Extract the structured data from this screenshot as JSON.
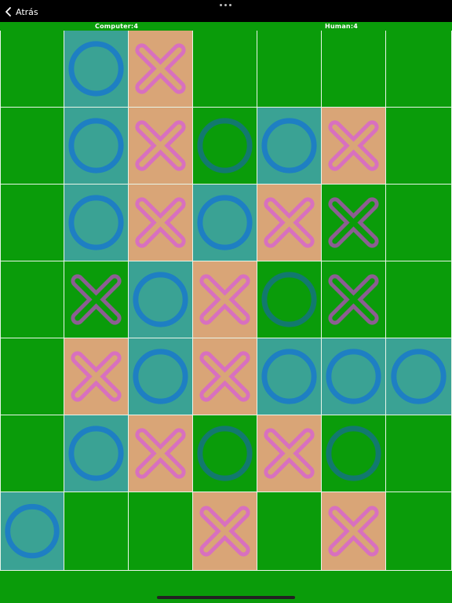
{
  "nav": {
    "back_label": "Atrás"
  },
  "scores": {
    "computer": "Computer:4",
    "human": "Human:4"
  },
  "colors": {
    "board": "#0a9c0a",
    "line": "#e8f5e8",
    "o_highlight_bg": "#3aa294",
    "x_highlight_bg": "#d9a577",
    "o_highlight_stroke": "#1e7fc3",
    "x_highlight_stroke": "#d870bf",
    "o_plain_stroke": "#12796e",
    "x_plain_stroke": "#8c5e92"
  },
  "board": {
    "rows": 7,
    "cols": 7,
    "cells": [
      [
        "",
        "O*",
        "X*",
        "",
        "",
        "",
        ""
      ],
      [
        "",
        "O*",
        "X*",
        "O",
        "O*",
        "X*",
        ""
      ],
      [
        "",
        "O*",
        "X*",
        "O*",
        "X*",
        "X",
        ""
      ],
      [
        "",
        "X",
        "O*",
        "X*",
        "O",
        "X",
        ""
      ],
      [
        "",
        "X*",
        "O*",
        "X*",
        "O*",
        "O*",
        "O*"
      ],
      [
        "",
        "O*",
        "X*",
        "O",
        "X*",
        "O",
        ""
      ],
      [
        "O*",
        "",
        "",
        "X*",
        "",
        "X*",
        ""
      ]
    ]
  }
}
